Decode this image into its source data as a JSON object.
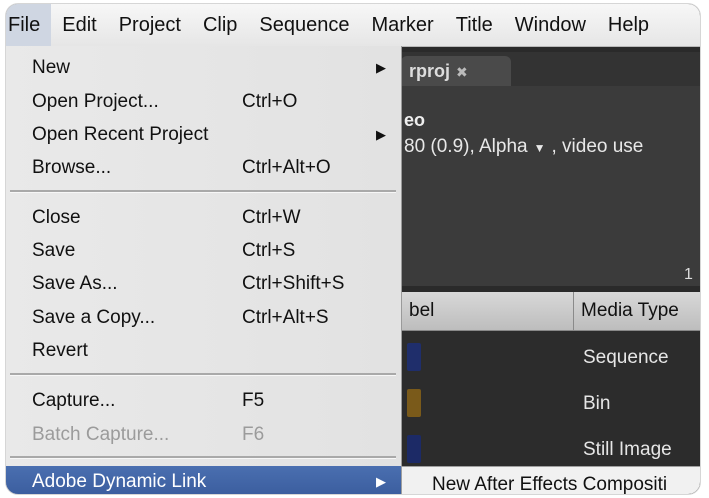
{
  "menubar": {
    "items": [
      "File",
      "Edit",
      "Project",
      "Clip",
      "Sequence",
      "Marker",
      "Title",
      "Window",
      "Help"
    ]
  },
  "file_menu": {
    "items": [
      {
        "label": "New",
        "shortcut": "",
        "submenu": true
      },
      {
        "label": "Open Project...",
        "shortcut": "Ctrl+O"
      },
      {
        "label": "Open Recent Project",
        "shortcut": "",
        "submenu": true
      },
      {
        "label": "Browse...",
        "shortcut": "Ctrl+Alt+O"
      },
      {
        "label": "Close",
        "shortcut": "Ctrl+W"
      },
      {
        "label": "Save",
        "shortcut": "Ctrl+S"
      },
      {
        "label": "Save As...",
        "shortcut": "Ctrl+Shift+S"
      },
      {
        "label": "Save a Copy...",
        "shortcut": "Ctrl+Alt+S"
      },
      {
        "label": "Revert",
        "shortcut": ""
      },
      {
        "label": "Capture...",
        "shortcut": "F5"
      },
      {
        "label": "Batch Capture...",
        "shortcut": "F6",
        "disabled": true
      },
      {
        "label": "Adobe Dynamic Link",
        "shortcut": "",
        "submenu": true,
        "highlighted": true
      }
    ]
  },
  "submenu": {
    "item": "New After Effects Compositi"
  },
  "background": {
    "tab_label": "rproj",
    "panel_title": "eo",
    "info_prefix": "80 (0.9), Alpha",
    "info_suffix": ", video use",
    "count": "1",
    "columns": [
      "bel",
      "Media Type"
    ],
    "rows": [
      "Sequence",
      "Bin",
      "Still Image"
    ],
    "row_swatch_colors": [
      "#1f2e6b",
      "#7a5a1a",
      "#1c2a66"
    ]
  },
  "colors": {
    "highlight": "#3f63a5",
    "menu_bg": "#e6e6e6"
  }
}
